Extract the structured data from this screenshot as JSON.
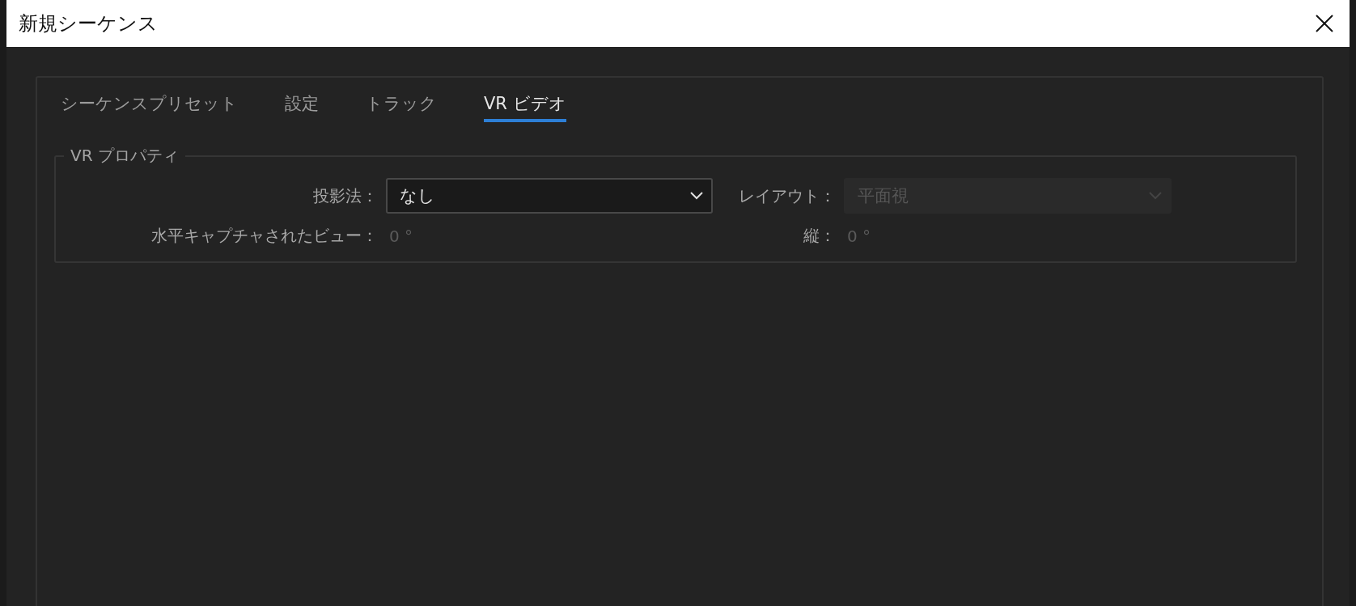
{
  "window": {
    "title": "新規シーケンス"
  },
  "tabs": [
    {
      "label": "シーケンスプリセット",
      "selected": false
    },
    {
      "label": "設定",
      "selected": false
    },
    {
      "label": "トラック",
      "selected": false
    },
    {
      "label": "VR ビデオ",
      "selected": true
    }
  ],
  "vr_properties": {
    "title": "VR プロパティ",
    "fields": [
      {
        "kind": "select",
        "label": "投影法：",
        "value": "なし",
        "disabled": false
      },
      {
        "kind": "select",
        "label": "レイアウト：",
        "value": "平面視",
        "disabled": true
      },
      {
        "kind": "reading",
        "label": "水平キャプチャされたビュー：",
        "value": "0 °",
        "disabled": true
      },
      {
        "kind": "reading",
        "label": "縦：",
        "value": "0 °",
        "disabled": true
      }
    ]
  }
}
